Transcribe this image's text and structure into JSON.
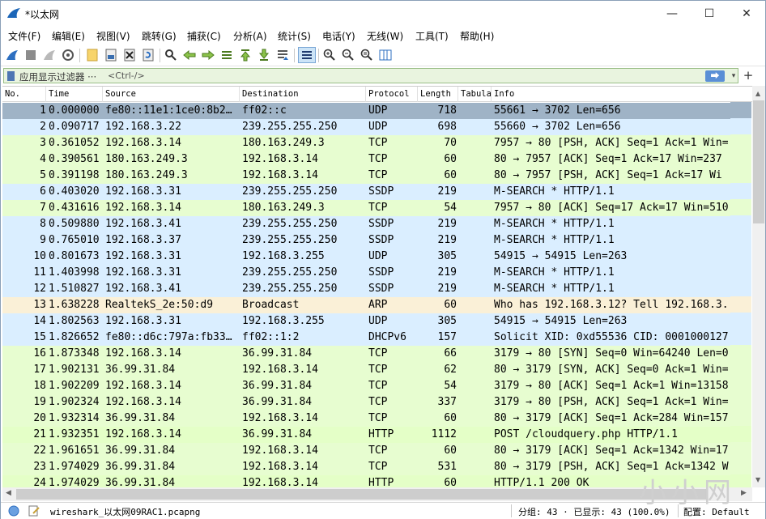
{
  "window": {
    "title": "*以太网",
    "minimize": "—",
    "maximize": "☐",
    "close": "✕"
  },
  "menus": [
    "文件(F)",
    "编辑(E)",
    "视图(V)",
    "跳转(G)",
    "捕获(C)",
    "分析(A)",
    "统计(S)",
    "电话(Y)",
    "无线(W)",
    "工具(T)",
    "帮助(H)"
  ],
  "filter": {
    "label": "应用显示过滤器 ···",
    "placeholder": "<Ctrl-/>",
    "apply": "⮕",
    "dropdown": "▾",
    "add": "+"
  },
  "columns": [
    "No.",
    "Time",
    "Source",
    "Destination",
    "Protocol",
    "Length",
    "Tabula",
    "Info"
  ],
  "packets": [
    {
      "no": "1",
      "time": "0.000000",
      "src": "fe80::11e1:1ce0:8b2…",
      "dst": "ff02::c",
      "proto": "UDP",
      "len": "718",
      "info": "55661 → 3702 Len=656",
      "color": "#9fb3c6"
    },
    {
      "no": "2",
      "time": "0.090717",
      "src": "192.168.3.22",
      "dst": "239.255.255.250",
      "proto": "UDP",
      "len": "698",
      "info": "55660 → 3702 Len=656",
      "color": "#daeeff"
    },
    {
      "no": "3",
      "time": "0.361052",
      "src": "192.168.3.14",
      "dst": "180.163.249.3",
      "proto": "TCP",
      "len": "70",
      "info": "7957 → 80 [PSH, ACK] Seq=1 Ack=1 Win=",
      "color": "#e7fdd0"
    },
    {
      "no": "4",
      "time": "0.390561",
      "src": "180.163.249.3",
      "dst": "192.168.3.14",
      "proto": "TCP",
      "len": "60",
      "info": "80 → 7957 [ACK] Seq=1 Ack=17 Win=237",
      "color": "#e7fdd0"
    },
    {
      "no": "5",
      "time": "0.391198",
      "src": "180.163.249.3",
      "dst": "192.168.3.14",
      "proto": "TCP",
      "len": "60",
      "info": "80 → 7957 [PSH, ACK] Seq=1 Ack=17 Wi",
      "color": "#e7fdd0"
    },
    {
      "no": "6",
      "time": "0.403020",
      "src": "192.168.3.31",
      "dst": "239.255.255.250",
      "proto": "SSDP",
      "len": "219",
      "info": "M-SEARCH * HTTP/1.1",
      "color": "#daeeff"
    },
    {
      "no": "7",
      "time": "0.431616",
      "src": "192.168.3.14",
      "dst": "180.163.249.3",
      "proto": "TCP",
      "len": "54",
      "info": "7957 → 80 [ACK] Seq=17 Ack=17 Win=510",
      "color": "#e7fdd0"
    },
    {
      "no": "8",
      "time": "0.509880",
      "src": "192.168.3.41",
      "dst": "239.255.255.250",
      "proto": "SSDP",
      "len": "219",
      "info": "M-SEARCH * HTTP/1.1",
      "color": "#daeeff"
    },
    {
      "no": "9",
      "time": "0.765010",
      "src": "192.168.3.37",
      "dst": "239.255.255.250",
      "proto": "SSDP",
      "len": "219",
      "info": "M-SEARCH * HTTP/1.1",
      "color": "#daeeff"
    },
    {
      "no": "10",
      "time": "0.801673",
      "src": "192.168.3.31",
      "dst": "192.168.3.255",
      "proto": "UDP",
      "len": "305",
      "info": "54915 → 54915 Len=263",
      "color": "#daeeff"
    },
    {
      "no": "11",
      "time": "1.403998",
      "src": "192.168.3.31",
      "dst": "239.255.255.250",
      "proto": "SSDP",
      "len": "219",
      "info": "M-SEARCH * HTTP/1.1",
      "color": "#daeeff"
    },
    {
      "no": "12",
      "time": "1.510827",
      "src": "192.168.3.41",
      "dst": "239.255.255.250",
      "proto": "SSDP",
      "len": "219",
      "info": "M-SEARCH * HTTP/1.1",
      "color": "#daeeff"
    },
    {
      "no": "13",
      "time": "1.638228",
      "src": "RealtekS_2e:50:d9",
      "dst": "Broadcast",
      "proto": "ARP",
      "len": "60",
      "info": "Who has 192.168.3.12? Tell 192.168.3.",
      "color": "#faf0d7"
    },
    {
      "no": "14",
      "time": "1.802563",
      "src": "192.168.3.31",
      "dst": "192.168.3.255",
      "proto": "UDP",
      "len": "305",
      "info": "54915 → 54915 Len=263",
      "color": "#daeeff"
    },
    {
      "no": "15",
      "time": "1.826652",
      "src": "fe80::d6c:797a:fb33…",
      "dst": "ff02::1:2",
      "proto": "DHCPv6",
      "len": "157",
      "info": "Solicit XID: 0xd55536 CID: 0001000127",
      "color": "#daeeff"
    },
    {
      "no": "16",
      "time": "1.873348",
      "src": "192.168.3.14",
      "dst": "36.99.31.84",
      "proto": "TCP",
      "len": "66",
      "info": "3179 → 80 [SYN] Seq=0 Win=64240 Len=0",
      "color": "#e7fdd0"
    },
    {
      "no": "17",
      "time": "1.902131",
      "src": "36.99.31.84",
      "dst": "192.168.3.14",
      "proto": "TCP",
      "len": "62",
      "info": "80 → 3179 [SYN, ACK] Seq=0 Ack=1 Win=",
      "color": "#e7fdd0"
    },
    {
      "no": "18",
      "time": "1.902209",
      "src": "192.168.3.14",
      "dst": "36.99.31.84",
      "proto": "TCP",
      "len": "54",
      "info": "3179 → 80 [ACK] Seq=1 Ack=1 Win=13158",
      "color": "#e7fdd0"
    },
    {
      "no": "19",
      "time": "1.902324",
      "src": "192.168.3.14",
      "dst": "36.99.31.84",
      "proto": "TCP",
      "len": "337",
      "info": "3179 → 80 [PSH, ACK] Seq=1 Ack=1 Win=",
      "color": "#e7fdd0"
    },
    {
      "no": "20",
      "time": "1.932314",
      "src": "36.99.31.84",
      "dst": "192.168.3.14",
      "proto": "TCP",
      "len": "60",
      "info": "80 → 3179 [ACK] Seq=1 Ack=284 Win=157",
      "color": "#e7fdd0"
    },
    {
      "no": "21",
      "time": "1.932351",
      "src": "192.168.3.14",
      "dst": "36.99.31.84",
      "proto": "HTTP",
      "len": "1112",
      "info": "POST /cloudquery.php HTTP/1.1",
      "color": "#e4ffc7"
    },
    {
      "no": "22",
      "time": "1.961651",
      "src": "36.99.31.84",
      "dst": "192.168.3.14",
      "proto": "TCP",
      "len": "60",
      "info": "80 → 3179 [ACK] Seq=1 Ack=1342 Win=17",
      "color": "#e7fdd0"
    },
    {
      "no": "23",
      "time": "1.974029",
      "src": "36.99.31.84",
      "dst": "192.168.3.14",
      "proto": "TCP",
      "len": "531",
      "info": "80 → 3179 [PSH, ACK] Seq=1 Ack=1342 W",
      "color": "#e7fdd0"
    },
    {
      "no": "24",
      "time": "1.974029",
      "src": "36.99.31.84",
      "dst": "192.168.3.14",
      "proto": "HTTP",
      "len": "60",
      "info": "HTTP/1.1 200 OK",
      "color": "#e4ffc7"
    }
  ],
  "status": {
    "file": "wireshark_以太网09RAC1.pcapng",
    "packets": "分组: 43 · 已显示: 43 (100.0%)",
    "profile": "配置: Default"
  },
  "watermark": "小小网",
  "colors": {
    "selected": "#9fb3c6",
    "udp": "#daeeff",
    "tcp": "#e7fdd0",
    "http": "#e4ffc7",
    "arp": "#faf0d7"
  }
}
